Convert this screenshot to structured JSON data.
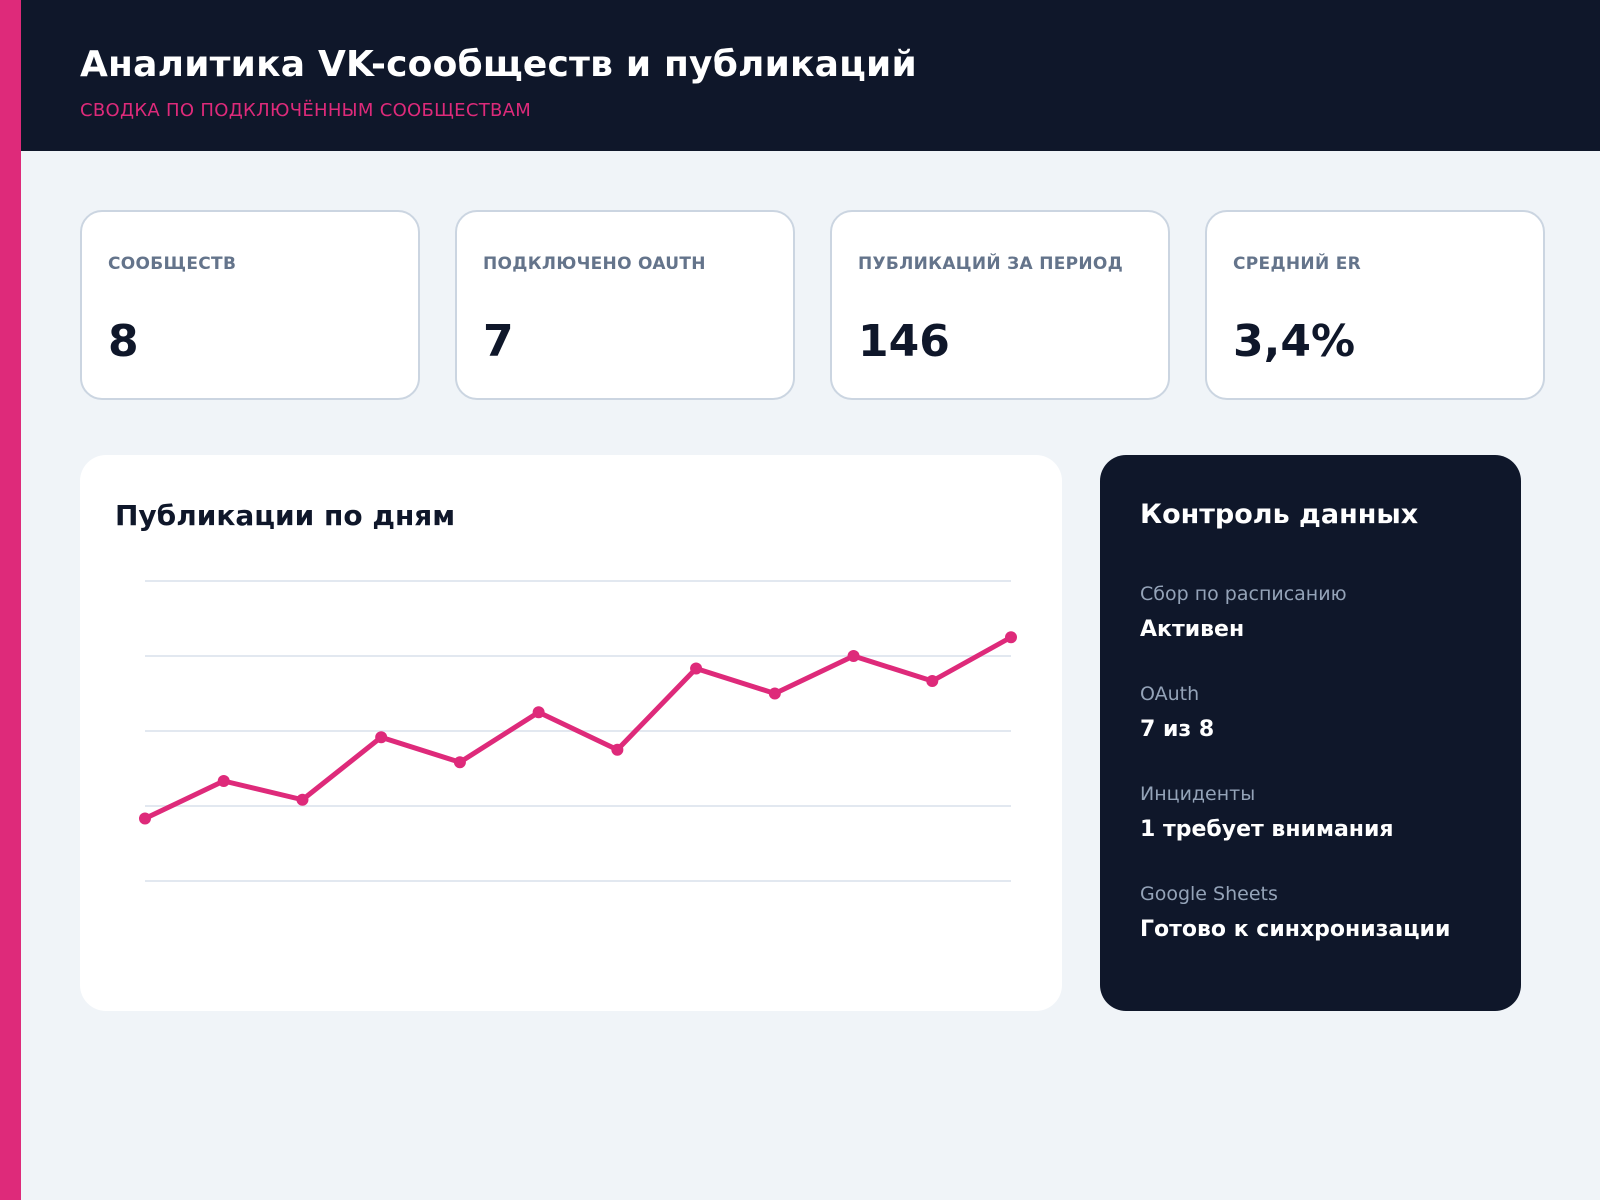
{
  "header": {
    "title": "Аналитика VK-сообществ и публикаций",
    "subtitle": "СВОДКА ПО ПОДКЛЮЧЁННЫМ СООБЩЕСТВАМ"
  },
  "kpis": [
    {
      "label": "СООБЩЕСТВ",
      "value": "8"
    },
    {
      "label": "ПОДКЛЮЧЕНО OAUTH",
      "value": "7"
    },
    {
      "label": "ПУБЛИКАЦИЙ ЗА ПЕРИОД",
      "value": "146"
    },
    {
      "label": "СРЕДНИЙ ER",
      "value": "3,4%"
    }
  ],
  "chart": {
    "title": "Публикации по дням"
  },
  "chart_data": {
    "type": "line",
    "title": "Публикации по дням",
    "x": [
      1,
      2,
      3,
      4,
      5,
      6,
      7,
      8,
      9,
      10,
      11,
      12
    ],
    "values": [
      9,
      12,
      10.5,
      15.5,
      13.5,
      17.5,
      14.5,
      21,
      19,
      22,
      20,
      23.5
    ],
    "ylim": [
      4,
      28
    ],
    "grid": true,
    "color": "#de2a7a"
  },
  "control": {
    "title": "Контроль данных",
    "items": [
      {
        "label": "Сбор по расписанию",
        "value": "Активен"
      },
      {
        "label": "OAuth",
        "value": "7 из 8"
      },
      {
        "label": "Инциденты",
        "value": "1 требует внимания"
      },
      {
        "label": "Google Sheets",
        "value": "Готово к синхронизации"
      }
    ]
  },
  "colors": {
    "accent": "#de2a7a",
    "dark": "#0f172a",
    "background": "#f0f4f8"
  }
}
